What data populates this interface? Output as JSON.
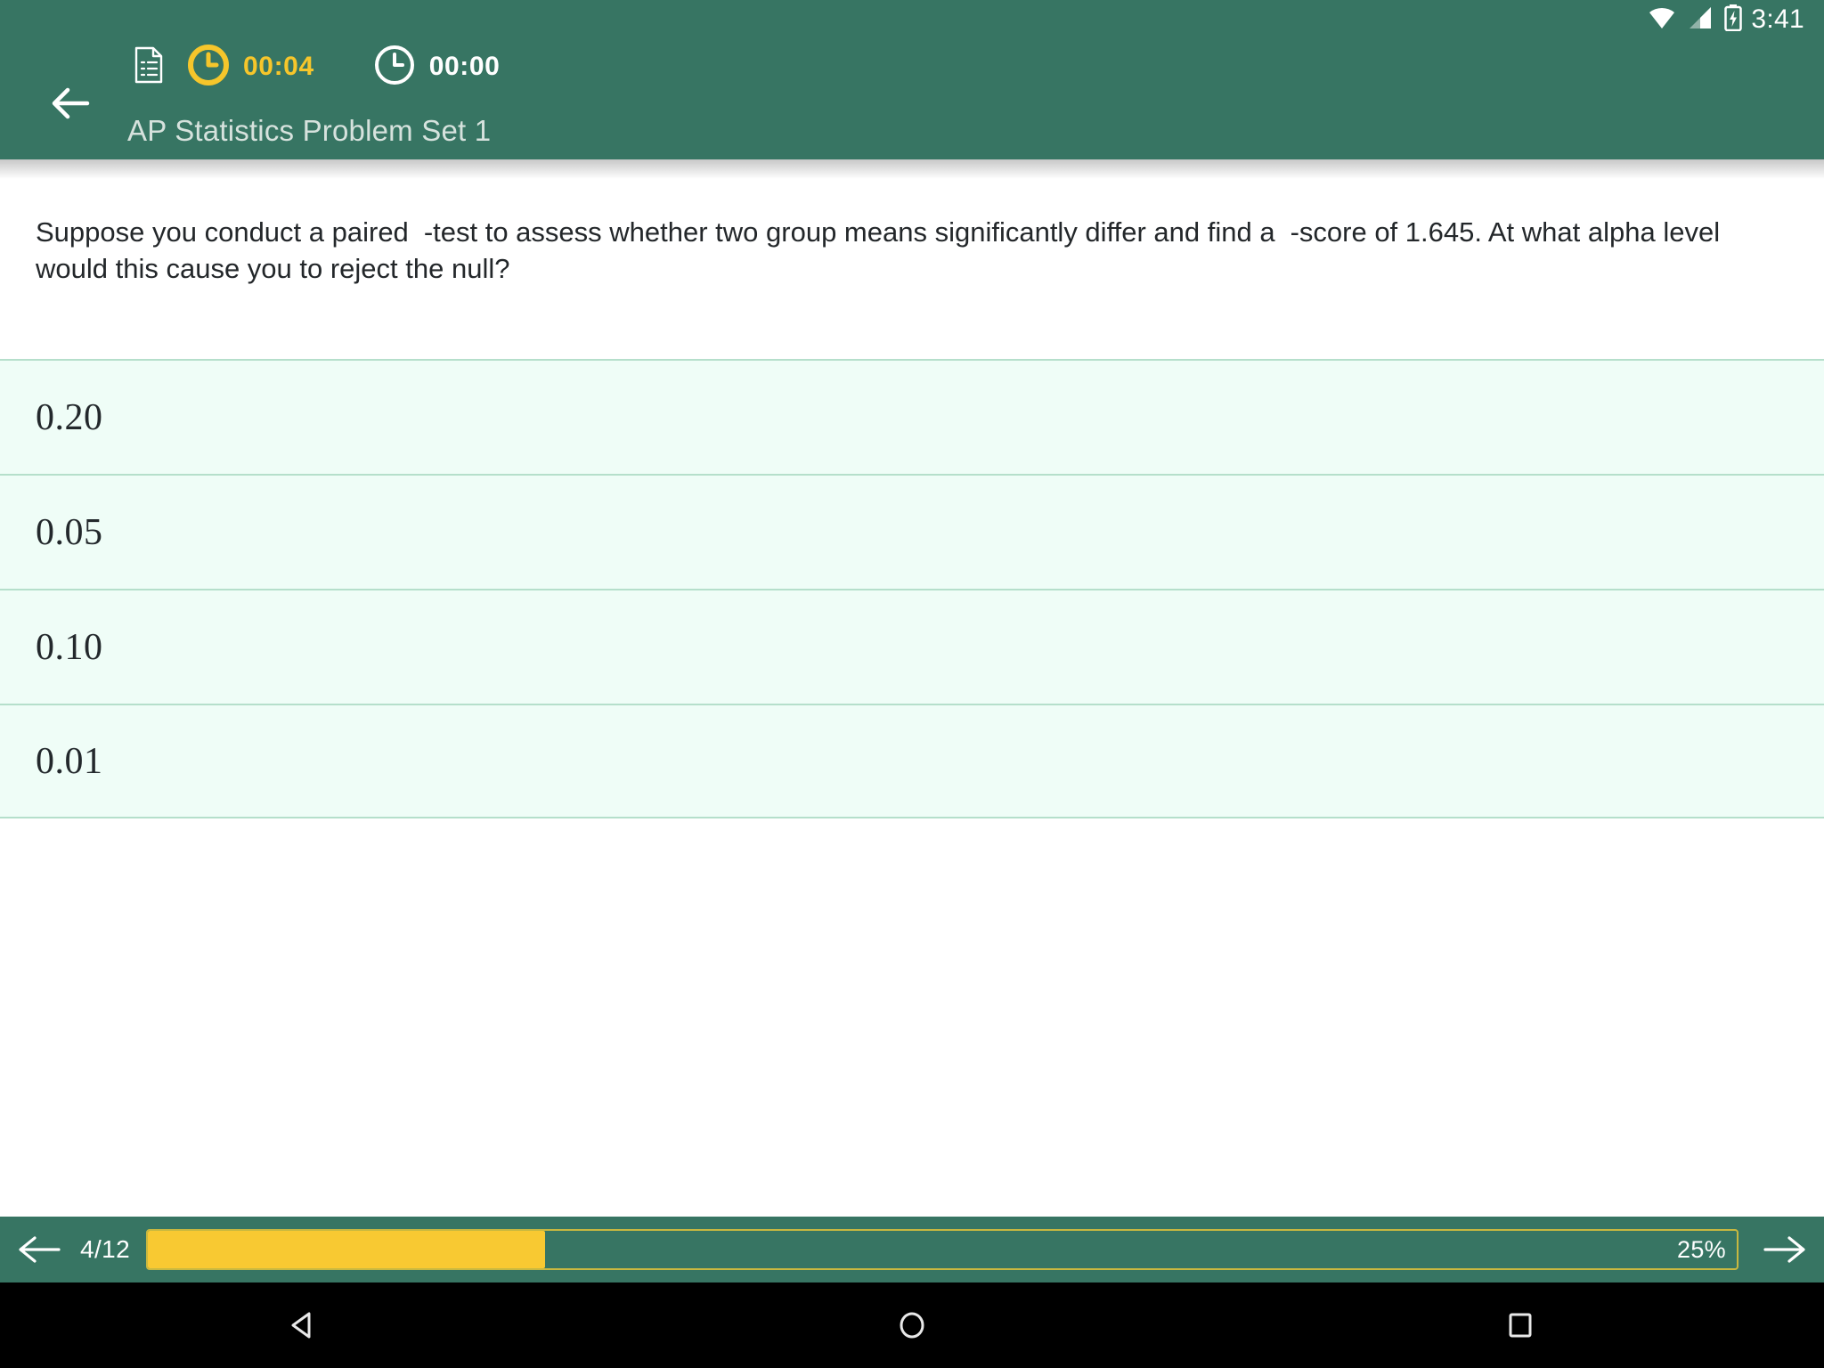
{
  "status_bar": {
    "time": "3:41",
    "icons": [
      "wifi-icon",
      "cellular-signal-icon",
      "battery-charging-icon"
    ]
  },
  "app_bar": {
    "back_label": "back-arrow",
    "title": "AP Statistics Problem Set 1",
    "document_icon": "document-checklist-icon",
    "timers": [
      {
        "icon": "clock-icon",
        "value": "00:04",
        "state": "active"
      },
      {
        "icon": "clock-icon",
        "value": "00:00",
        "state": "idle"
      }
    ]
  },
  "question": {
    "part1": "Suppose you conduct a paired",
    "part2": "-test to assess whether two group means significantly differ and find a",
    "part3": "-score of 1.645. At what alpha level would this cause you to reject the null?"
  },
  "options": [
    {
      "label": "0.20"
    },
    {
      "label": "0.05"
    },
    {
      "label": "0.10"
    },
    {
      "label": "0.01"
    }
  ],
  "bottom_bar": {
    "prev_icon": "arrow-left-icon",
    "next_icon": "arrow-right-icon",
    "page_counter": "4/12",
    "progress_percent_label": "25%",
    "progress_percent_value": 25
  },
  "android_nav": {
    "back": "triangle-back-icon",
    "home": "circle-home-icon",
    "recents": "square-recents-icon"
  },
  "colors": {
    "brand_green": "#377563",
    "accent_yellow": "#f8c932",
    "option_bg": "#effdf7",
    "option_divider": "#b5dfcb",
    "text_dark": "#23272a"
  }
}
